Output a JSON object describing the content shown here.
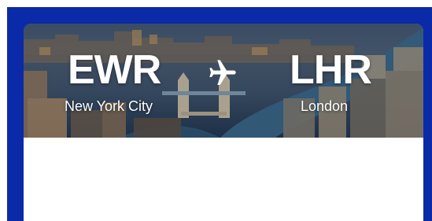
{
  "flight": {
    "origin": {
      "code": "EWR",
      "city": "New York City"
    },
    "destination": {
      "code": "LHR",
      "city": "London"
    }
  },
  "icons": {
    "direction": "airplane-icon"
  },
  "colors": {
    "frame": "#0a2aa8",
    "card": "#ffffff",
    "text": "#ffffff"
  }
}
